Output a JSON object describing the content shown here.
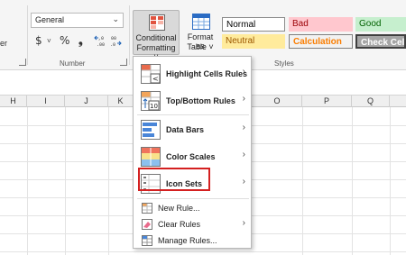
{
  "ribbon": {
    "partial_label": "er",
    "number": {
      "format_value": "General",
      "currency_symbol": "$",
      "percent_symbol": "%",
      "comma_symbol": "❟",
      "group_label": "Number"
    },
    "conditional_formatting": {
      "line1": "Conditional",
      "line2": "Formatting ˅"
    },
    "format_as_table": {
      "line1": "Format as",
      "line2": "Table ˅"
    },
    "styles": {
      "group_label": "Styles",
      "cells": [
        {
          "label": "Normal",
          "bg": "#ffffff",
          "fg": "#000000",
          "border": "#8a8a8a"
        },
        {
          "label": "Bad",
          "bg": "#ffc7ce",
          "fg": "#9c0006",
          "border": "#ffc7ce"
        },
        {
          "label": "Good",
          "bg": "#c6efce",
          "fg": "#006100",
          "border": "#c6efce"
        },
        {
          "label": "Neutral",
          "bg": "#ffeb9c",
          "fg": "#9c5700",
          "border": "#ffeb9c"
        },
        {
          "label": "Calculation",
          "bg": "#f2f2f2",
          "fg": "#fa7d00",
          "border": "#7f7f7f"
        },
        {
          "label": "Check Cell",
          "bg": "#a5a5a5",
          "fg": "#ffffff",
          "border": "#3f3f3f"
        }
      ]
    }
  },
  "sheet": {
    "columns": [
      "H",
      "I",
      "J",
      "K",
      "O",
      "P",
      "Q"
    ]
  },
  "menu": {
    "items": [
      {
        "label": "Highlight Cells Rules",
        "icon": "highlight-cells-rules-icon"
      },
      {
        "label": "Top/Bottom Rules",
        "icon": "top-bottom-rules-icon"
      },
      {
        "label": "Data Bars",
        "icon": "data-bars-icon"
      },
      {
        "label": "Color Scales",
        "icon": "color-scales-icon"
      },
      {
        "label": "Icon Sets",
        "icon": "icon-sets-icon"
      },
      {
        "label": "New Rule...",
        "icon": "new-rule-icon"
      },
      {
        "label": "Clear Rules",
        "icon": "clear-rules-icon"
      },
      {
        "label": "Manage Rules...",
        "icon": "manage-rules-icon"
      }
    ],
    "highlighted_item": "Icon Sets",
    "highlight_color": "#d42020"
  }
}
